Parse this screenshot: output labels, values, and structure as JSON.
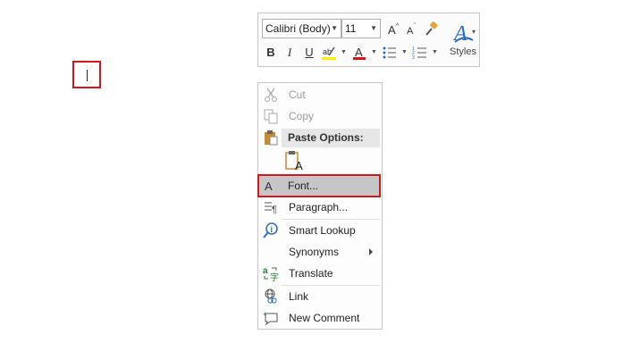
{
  "mini_toolbar": {
    "font_name": "Calibri (Body)",
    "font_size": "11",
    "bold": "B",
    "italic": "I",
    "underline": "U",
    "styles_label": "Styles",
    "accent_red": "#d9141b",
    "highlight_yellow": "#ffef00",
    "icons": [
      "grow-font-icon",
      "shrink-font-icon",
      "format-painter-icon",
      "highlight-icon",
      "font-color-icon",
      "bullets-icon",
      "numbering-icon",
      "styles-icon"
    ]
  },
  "context_menu": {
    "items": [
      {
        "label": "Cut",
        "icon": "scissors-icon",
        "enabled": false
      },
      {
        "label": "Copy",
        "icon": "copy-icon",
        "enabled": false
      },
      {
        "label": "Paste Options:",
        "icon": "clipboard-icon",
        "enabled": true
      },
      {
        "label": "Font...",
        "icon": "font-icon",
        "enabled": true,
        "selected": true
      },
      {
        "label": "Paragraph...",
        "icon": "paragraph-icon",
        "enabled": true
      },
      {
        "label": "Smart Lookup",
        "icon": "search-info-icon",
        "enabled": true
      },
      {
        "label": "Synonyms",
        "icon": "",
        "enabled": true,
        "submenu": true
      },
      {
        "label": "Translate",
        "icon": "translate-icon",
        "enabled": true
      },
      {
        "label": "Link",
        "icon": "link-icon",
        "enabled": true
      },
      {
        "label": "New Comment",
        "icon": "comment-icon",
        "enabled": true
      }
    ],
    "font_icon_glyph": "A",
    "paste_icon_glyph": "A"
  },
  "highlight_color": "#d9141b"
}
